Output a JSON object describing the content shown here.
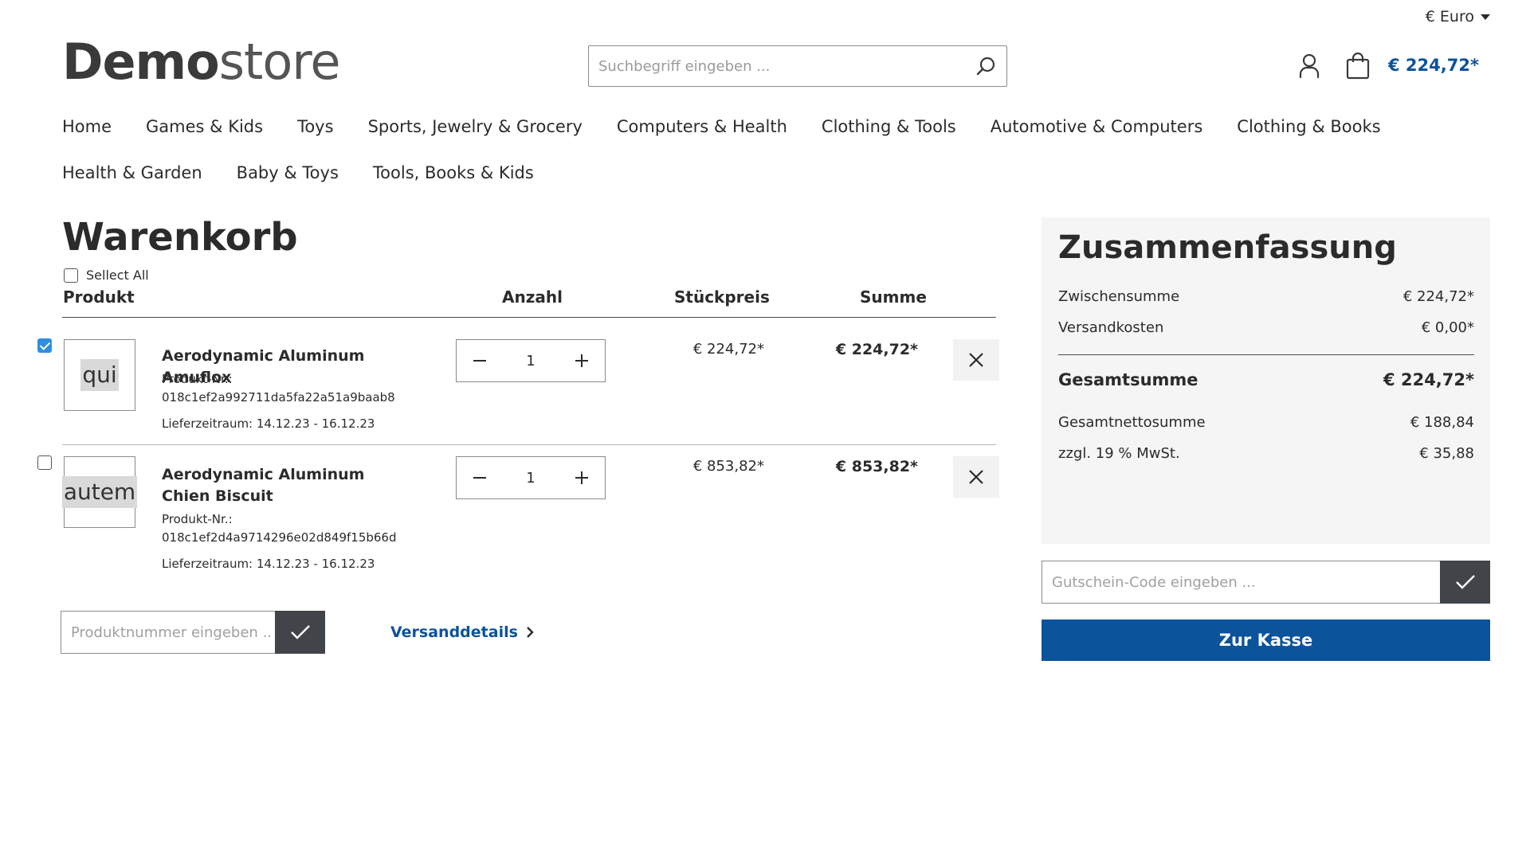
{
  "header": {
    "currency": "€ Euro",
    "logo_bold": "Demo",
    "logo_light": "store",
    "search_placeholder": "Suchbegriff eingeben ...",
    "cart_total": "€ 224,72*"
  },
  "nav": {
    "row1": [
      "Home",
      "Games & Kids",
      "Toys",
      "Sports, Jewelry & Grocery",
      "Computers & Health",
      "Clothing & Tools",
      "Automotive & Computers",
      "Clothing & Books"
    ],
    "row2": [
      "Health & Garden",
      "Baby & Toys",
      "Tools, Books & Kids"
    ]
  },
  "cart": {
    "title": "Warenkorb",
    "select_all": "Sellect All",
    "columns": {
      "product": "Produkt",
      "quantity": "Anzahl",
      "unit_price": "Stückpreis",
      "total": "Summe"
    },
    "items": [
      {
        "checked": true,
        "thumb": "qui",
        "name": "Aerodynamic Aluminum Amuflox",
        "sku_label": "Produkt-Nr.:",
        "sku": "018c1ef2a992711da5fa22a51a9baab8",
        "delivery": "Lieferzeitraum: 14.12.23 - 16.12.23",
        "qty": "1",
        "unit_price": "€ 224,72*",
        "total": "€ 224,72*"
      },
      {
        "checked": false,
        "thumb": "autem",
        "name": "Aerodynamic Aluminum Chien Biscuit",
        "sku_label": "Produkt-Nr.:",
        "sku": "018c1ef2d4a9714296e02d849f15b66d",
        "delivery": "Lieferzeitraum: 14.12.23 - 16.12.23",
        "qty": "1",
        "unit_price": "€ 853,82*",
        "total": "€ 853,82*"
      }
    ],
    "product_number_placeholder": "Produktnummer eingeben ...",
    "shipping_link": "Versanddetails"
  },
  "summary": {
    "title": "Zusammenfassung",
    "subtotal_label": "Zwischensumme",
    "subtotal": "€ 224,72*",
    "shipping_label": "Versandkosten",
    "shipping": "€ 0,00*",
    "grand_total_label": "Gesamtsumme",
    "grand_total": "€ 224,72*",
    "net_label": "Gesamtnettosumme",
    "net": "€ 188,84",
    "vat_label": "zzgl. 19 % MwSt.",
    "vat": "€ 35,88",
    "voucher_placeholder": "Gutschein-Code eingeben ...",
    "checkout": "Zur Kasse"
  },
  "colors": {
    "accent": "#0b539b",
    "dark_button": "#414549",
    "checkbox": "#2e8fe0"
  }
}
